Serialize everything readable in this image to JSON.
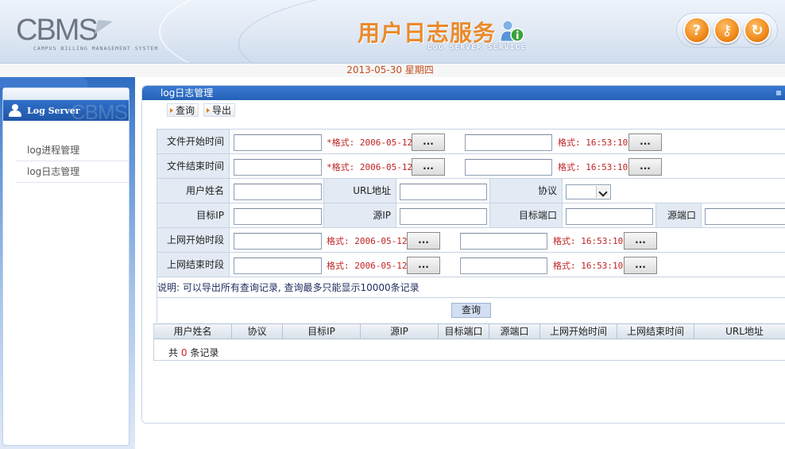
{
  "header": {
    "logo": "CBMS",
    "logo_sub": "CAMPUS BILLING MANAGEMENT SYSTEM",
    "title": "用户日志服务",
    "subtitle": "LOG SERVER SERVICE",
    "buttons": [
      {
        "icon": "help-icon",
        "glyph": "?"
      },
      {
        "icon": "key-icon",
        "glyph": "⚷"
      },
      {
        "icon": "logout-icon",
        "glyph": "↻"
      }
    ],
    "accent": "#e98a2c"
  },
  "date": "2013-05-30 星期四",
  "sidebar": {
    "title": "Log Server",
    "ghost": "CBMS",
    "items": [
      {
        "label": "log进程管理"
      },
      {
        "label": "log日志管理"
      }
    ]
  },
  "main": {
    "title": "log日志管理",
    "toolbar": {
      "query": "查询",
      "export": "导出"
    },
    "form": {
      "file_start_label": "文件开始时间",
      "file_end_label": "文件结束时间",
      "username_label": "用户姓名",
      "url_label": "URL地址",
      "protocol_label": "协议",
      "dest_ip_label": "目标IP",
      "src_ip_label": "源IP",
      "dest_port_label": "目标端口",
      "src_port_label": "源端口",
      "online_start_label": "上网开始时段",
      "online_end_label": "上网结束时段",
      "date_hint_required": "*格式: 2006-05-12",
      "date_hint": "格式: 2006-05-12",
      "time_hint": "格式: 16:53:10",
      "pick_button": "...",
      "protocol_value": ""
    },
    "note": "说明: 可以导出所有查询记录, 查询最多只能显示10000条记录",
    "query_button": "查询",
    "table": {
      "columns": [
        "用户姓名",
        "协议",
        "目标IP",
        "源IP",
        "目标端口",
        "源端口",
        "上网开始时间",
        "上网结束时间",
        "URL地址"
      ],
      "count_prefix": "共",
      "count": "0",
      "count_suffix": "条记录"
    }
  }
}
